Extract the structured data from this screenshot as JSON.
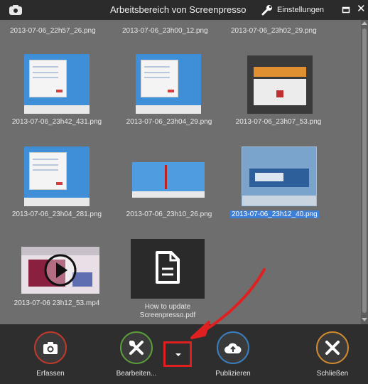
{
  "window": {
    "title": "Arbeitsbereich von Screenpresso",
    "settings_label": "Einstellungen"
  },
  "gallery": {
    "top_row_labels": [
      "2013-07-06_22h57_26.png",
      "2013-07-06_23h00_12.png",
      "2013-07-06_23h02_29.png"
    ],
    "items": [
      {
        "label": "2013-07-06_23h42_431.png",
        "kind": "screenshot",
        "selected": false
      },
      {
        "label": "2013-07-06_23h04_29.png",
        "kind": "screenshot",
        "selected": false
      },
      {
        "label": "2013-07-06_23h07_53.png",
        "kind": "webpage",
        "selected": false
      },
      {
        "label": "2013-07-06_23h04_281.png",
        "kind": "screenshot",
        "selected": false
      },
      {
        "label": "2013-07-06_23h10_26.png",
        "kind": "bluebanner",
        "selected": false
      },
      {
        "label": "2013-07-06_23h12_40.png",
        "kind": "bluepanel",
        "selected": true
      },
      {
        "label": "2013-07-06 23h12_53.mp4",
        "kind": "video",
        "selected": false
      },
      {
        "label": "How to update Screenpresso.pdf",
        "kind": "document",
        "selected": false
      }
    ]
  },
  "toolbar": {
    "capture_label": "Erfassen",
    "edit_label": "Bearbeiten...",
    "publish_label": "Publizieren",
    "close_label": "Schließen"
  },
  "colors": {
    "capture": "#c0392b",
    "edit": "#5a9e3a",
    "publish": "#3a7fc0",
    "close": "#d08a30",
    "highlight": "#e02020",
    "selection": "#3d7fd6"
  },
  "icons": {
    "app": "screenpresso-icon",
    "settings": "wrench-icon",
    "capture": "camera-icon",
    "edit": "tools-icon",
    "publish": "cloud-upload-icon",
    "close": "close-x-icon"
  }
}
